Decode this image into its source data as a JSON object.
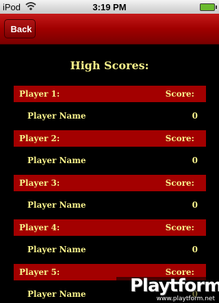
{
  "status_bar": {
    "carrier": "iPod",
    "time": "3:19 PM"
  },
  "nav": {
    "back_label": "Back"
  },
  "title": "High Scores:",
  "score_label": "Score:",
  "rows": [
    {
      "player": "Player 1:",
      "name": "Player Name",
      "score": "0"
    },
    {
      "player": "Player 2:",
      "name": "Player Name",
      "score": "0"
    },
    {
      "player": "Player 3:",
      "name": "Player Name",
      "score": "0"
    },
    {
      "player": "Player 4:",
      "name": "Player Name",
      "score": "0"
    },
    {
      "player": "Player 5:",
      "name": "Player Name",
      "score": "0"
    }
  ],
  "watermark": {
    "logo": "Playtform",
    "url": "www.playtform.net"
  },
  "colors": {
    "accent_red": "#a30000",
    "text_yellow": "#f6f08a",
    "background": "#000000"
  }
}
